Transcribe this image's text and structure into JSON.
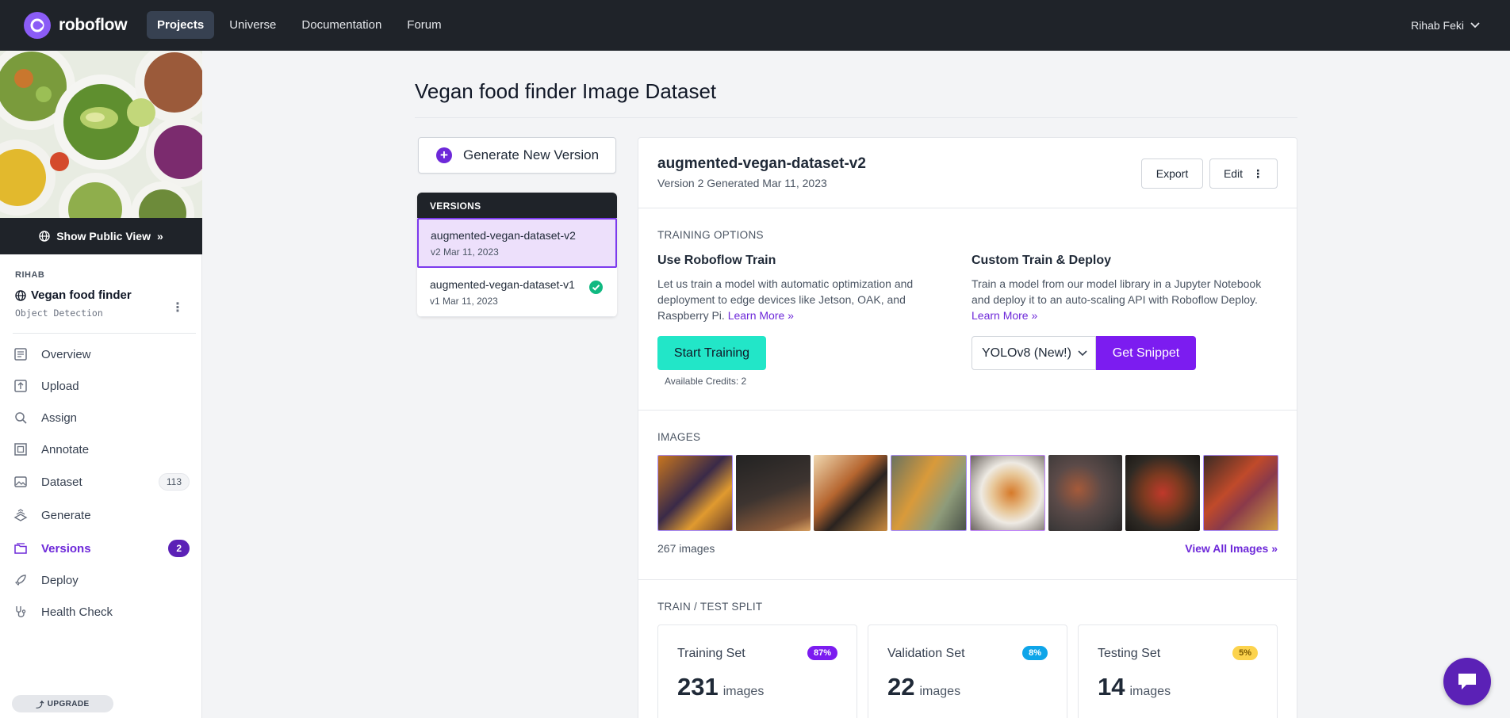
{
  "app": {
    "brand": "roboflow"
  },
  "topnav": {
    "links": [
      "Projects",
      "Universe",
      "Documentation",
      "Forum"
    ],
    "active": "Projects",
    "user_name": "Rihab Feki"
  },
  "sidebar": {
    "public_view_label": "Show Public View",
    "workspace": "RIHAB",
    "project_name": "Vegan food finder",
    "project_type": "Object Detection",
    "items": [
      {
        "label": "Overview",
        "icon": "overview-icon"
      },
      {
        "label": "Upload",
        "icon": "upload-icon"
      },
      {
        "label": "Assign",
        "icon": "search-icon"
      },
      {
        "label": "Annotate",
        "icon": "annotate-icon"
      },
      {
        "label": "Dataset",
        "icon": "images-icon",
        "count": "113"
      },
      {
        "label": "Generate",
        "icon": "generate-icon"
      },
      {
        "label": "Versions",
        "icon": "versions-icon",
        "count": "2",
        "active": true
      },
      {
        "label": "Deploy",
        "icon": "rocket-icon"
      },
      {
        "label": "Health Check",
        "icon": "stethoscope-icon"
      }
    ],
    "upgrade_label": "UPGRADE"
  },
  "main": {
    "page_title": "Vegan food finder Image Dataset",
    "generate_button": "Generate New Version",
    "versions_header": "VERSIONS",
    "versions": [
      {
        "name": "augmented-vegan-dataset-v2",
        "meta": "v2 Mar 11, 2023",
        "selected": true
      },
      {
        "name": "augmented-vegan-dataset-v1",
        "meta": "v1 Mar 11, 2023",
        "trained": true
      }
    ]
  },
  "detail": {
    "title": "augmented-vegan-dataset-v2",
    "subtitle": "Version 2 Generated Mar 11, 2023",
    "export_label": "Export",
    "edit_label": "Edit",
    "training_options_label": "TRAINING OPTIONS",
    "train": {
      "heading": "Use Roboflow Train",
      "desc": "Let us train a model with automatic optimization and deployment to edge devices like Jetson, OAK, and Raspberry Pi.",
      "learn_more": "Learn More",
      "button": "Start Training",
      "credits": "Available Credits: 2"
    },
    "custom": {
      "heading": "Custom Train & Deploy",
      "desc": "Train a model from our model library in a Jupyter Notebook and deploy it to an auto-scaling API with Roboflow Deploy.",
      "learn_more": "Learn More",
      "model_select": "YOLOv8 (New!)",
      "button": "Get Snippet"
    },
    "images_label": "IMAGES",
    "image_count": "267 images",
    "view_all": "View All Images",
    "split_label": "TRAIN / TEST SPLIT",
    "splits": [
      {
        "name": "Training Set",
        "pct": "87%",
        "count": "231",
        "unit": "images",
        "color": "#7c1cf0"
      },
      {
        "name": "Validation Set",
        "pct": "8%",
        "count": "22",
        "unit": "images",
        "color": "#0ea5e9"
      },
      {
        "name": "Testing Set",
        "pct": "5%",
        "count": "14",
        "unit": "images",
        "color": "#fcd34d"
      }
    ]
  },
  "colors": {
    "accent": "#6d28d9",
    "nav_bg": "#1f2329",
    "train_button": "#22e6c8",
    "snippet_button": "#7c1cf0"
  }
}
